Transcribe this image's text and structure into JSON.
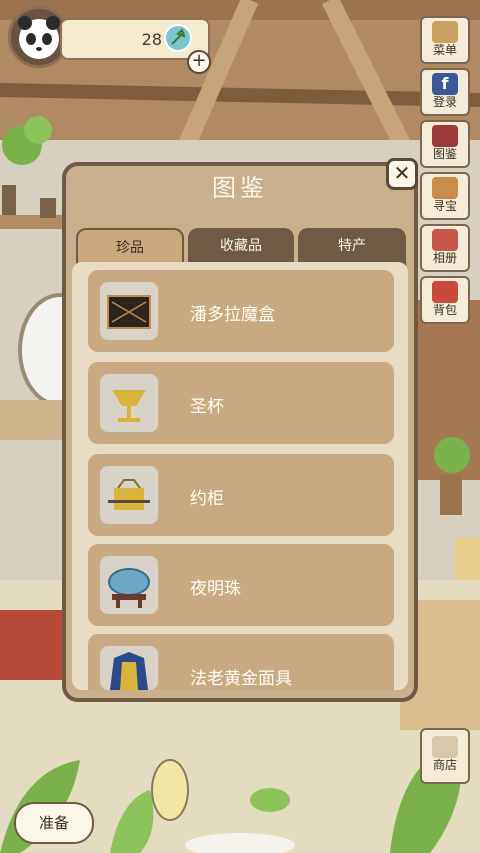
{
  "header": {
    "clover_count": "28"
  },
  "side_menu": [
    {
      "label": "菜单",
      "icon": "menu-icon",
      "color": "#c9a15e"
    },
    {
      "label": "登录",
      "icon": "facebook-icon",
      "color": "#3b5998"
    },
    {
      "label": "图鉴",
      "icon": "book-icon",
      "color": "#9a3a3a"
    },
    {
      "label": "寻宝",
      "icon": "shovel-icon",
      "color": "#c98c4a"
    },
    {
      "label": "相册",
      "icon": "album-icon",
      "color": "#c9564a"
    },
    {
      "label": "背包",
      "icon": "bag-icon",
      "color": "#c94a3a"
    }
  ],
  "shop": {
    "label": "商店",
    "icon": "cart-icon"
  },
  "prepare": {
    "label": "准备"
  },
  "panel": {
    "title": "图鉴",
    "tabs": [
      {
        "label": "珍品",
        "active": true
      },
      {
        "label": "收藏品",
        "active": false
      },
      {
        "label": "特产",
        "active": false
      }
    ],
    "items": [
      {
        "name": "潘多拉魔盒",
        "icon": "pandora-box-icon"
      },
      {
        "name": "圣杯",
        "icon": "holy-grail-icon"
      },
      {
        "name": "约柜",
        "icon": "ark-icon"
      },
      {
        "name": "夜明珠",
        "icon": "pearl-icon"
      },
      {
        "name": "法老黄金面具",
        "icon": "pharaoh-mask-icon"
      }
    ]
  }
}
